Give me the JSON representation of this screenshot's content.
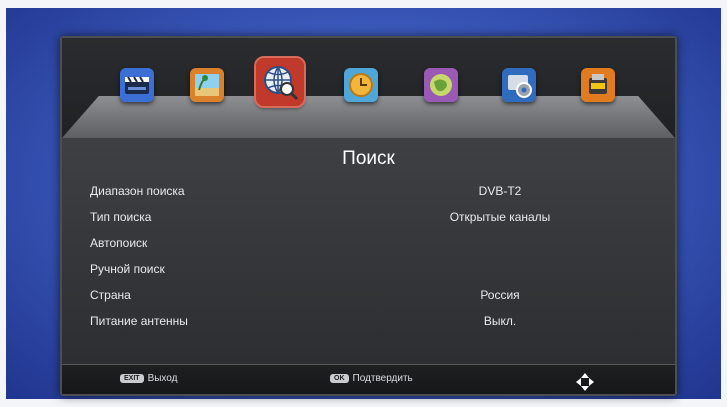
{
  "menu": {
    "icons": [
      {
        "name": "media-player-icon",
        "color": "#3b6fd6"
      },
      {
        "name": "picture-icon",
        "color": "#d9822b"
      },
      {
        "name": "channel-search-icon",
        "color": "#c0392b",
        "active": true
      },
      {
        "name": "time-icon",
        "color": "#e0a322"
      },
      {
        "name": "option-icon",
        "color": "#9b59b6"
      },
      {
        "name": "system-settings-icon",
        "color": "#2f6bbf"
      },
      {
        "name": "usb-icon",
        "color": "#e07b20"
      }
    ]
  },
  "page": {
    "title": "Поиск"
  },
  "settings": {
    "rows": [
      {
        "label": "Диапазон поиска",
        "value": "DVB-T2"
      },
      {
        "label": "Тип поиска",
        "value": "Открытые каналы"
      },
      {
        "label": "Автопоиск",
        "value": ""
      },
      {
        "label": "Ручной поиск",
        "value": ""
      },
      {
        "label": "Страна",
        "value": "Россия"
      },
      {
        "label": "Питание антенны",
        "value": "Выкл."
      }
    ]
  },
  "footer": {
    "exit_key": "EXIT",
    "exit_label": "Выход",
    "ok_key": "OK",
    "ok_label": "Подтвердить",
    "nav_icon": "navigation-arrows-icon"
  }
}
